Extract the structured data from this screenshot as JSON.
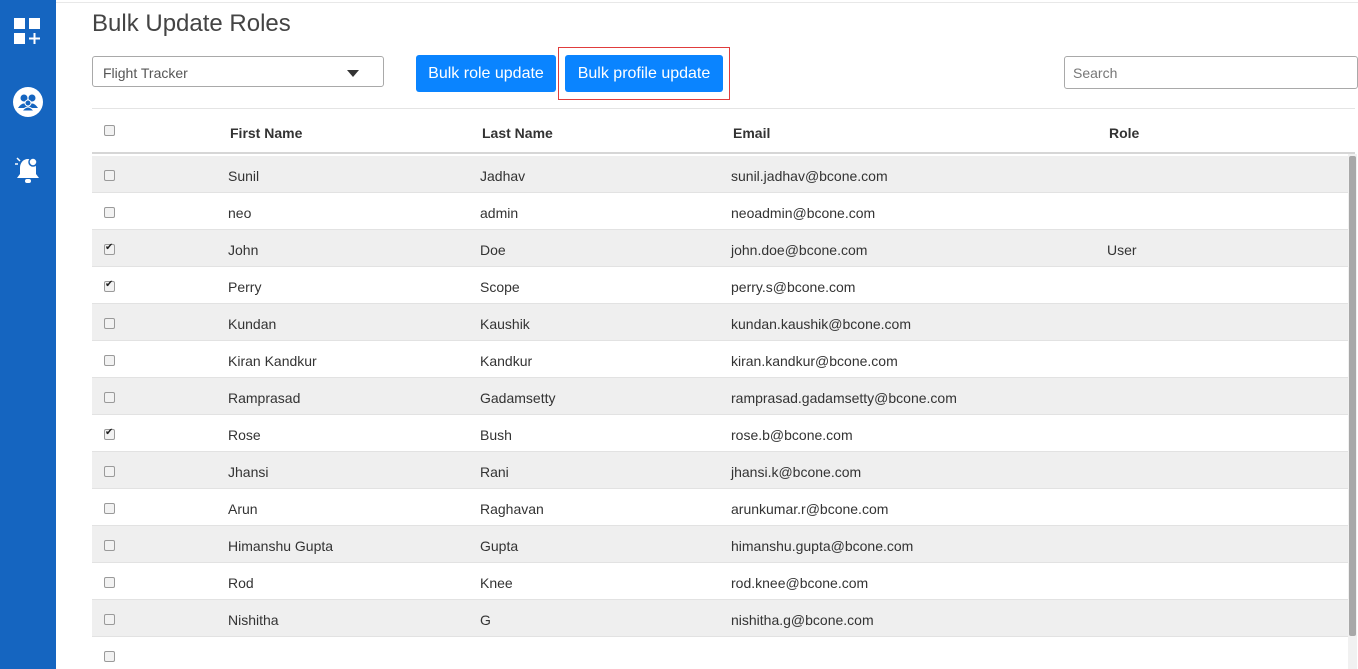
{
  "sidebar": {
    "items": [
      {
        "icon": "dashboard-add-icon"
      },
      {
        "icon": "users-group-icon"
      },
      {
        "icon": "notification-bell-icon"
      }
    ]
  },
  "page": {
    "title": "Bulk Update Roles"
  },
  "toolbar": {
    "app_select_value": "Flight Tracker",
    "bulk_role_label": "Bulk role update",
    "bulk_profile_label": "Bulk profile update",
    "search_placeholder": "Search"
  },
  "table": {
    "columns": [
      "First Name",
      "Last Name",
      "Email",
      "Role"
    ],
    "rows": [
      {
        "checked": false,
        "first": "Sunil",
        "last": "Jadhav",
        "email": "sunil.jadhav@bcone.com",
        "role": ""
      },
      {
        "checked": false,
        "first": "neo",
        "last": "admin",
        "email": "neoadmin@bcone.com",
        "role": ""
      },
      {
        "checked": true,
        "first": "John",
        "last": "Doe",
        "email": "john.doe@bcone.com",
        "role": "User"
      },
      {
        "checked": true,
        "first": "Perry",
        "last": "Scope",
        "email": "perry.s@bcone.com",
        "role": ""
      },
      {
        "checked": false,
        "first": "Kundan",
        "last": "Kaushik",
        "email": "kundan.kaushik@bcone.com",
        "role": ""
      },
      {
        "checked": false,
        "first": "Kiran Kandkur",
        "last": "Kandkur",
        "email": "kiran.kandkur@bcone.com",
        "role": ""
      },
      {
        "checked": false,
        "first": "Ramprasad",
        "last": "Gadamsetty",
        "email": "ramprasad.gadamsetty@bcone.com",
        "role": ""
      },
      {
        "checked": true,
        "first": "Rose",
        "last": "Bush",
        "email": "rose.b@bcone.com",
        "role": ""
      },
      {
        "checked": false,
        "first": "Jhansi",
        "last": "Rani",
        "email": "jhansi.k@bcone.com",
        "role": ""
      },
      {
        "checked": false,
        "first": "Arun",
        "last": "Raghavan",
        "email": "arunkumar.r@bcone.com",
        "role": ""
      },
      {
        "checked": false,
        "first": "Himanshu Gupta",
        "last": "Gupta",
        "email": "himanshu.gupta@bcone.com",
        "role": ""
      },
      {
        "checked": false,
        "first": "Rod",
        "last": "Knee",
        "email": "rod.knee@bcone.com",
        "role": ""
      },
      {
        "checked": false,
        "first": "Nishitha",
        "last": "G",
        "email": "nishitha.g@bcone.com",
        "role": ""
      },
      {
        "checked": false,
        "first": "",
        "last": "",
        "email": "",
        "role": ""
      }
    ]
  },
  "colors": {
    "sidebar": "#1565c0",
    "primary_button": "#0a84ff",
    "highlight_border": "#e03c3c",
    "alt_row": "#efefef"
  }
}
